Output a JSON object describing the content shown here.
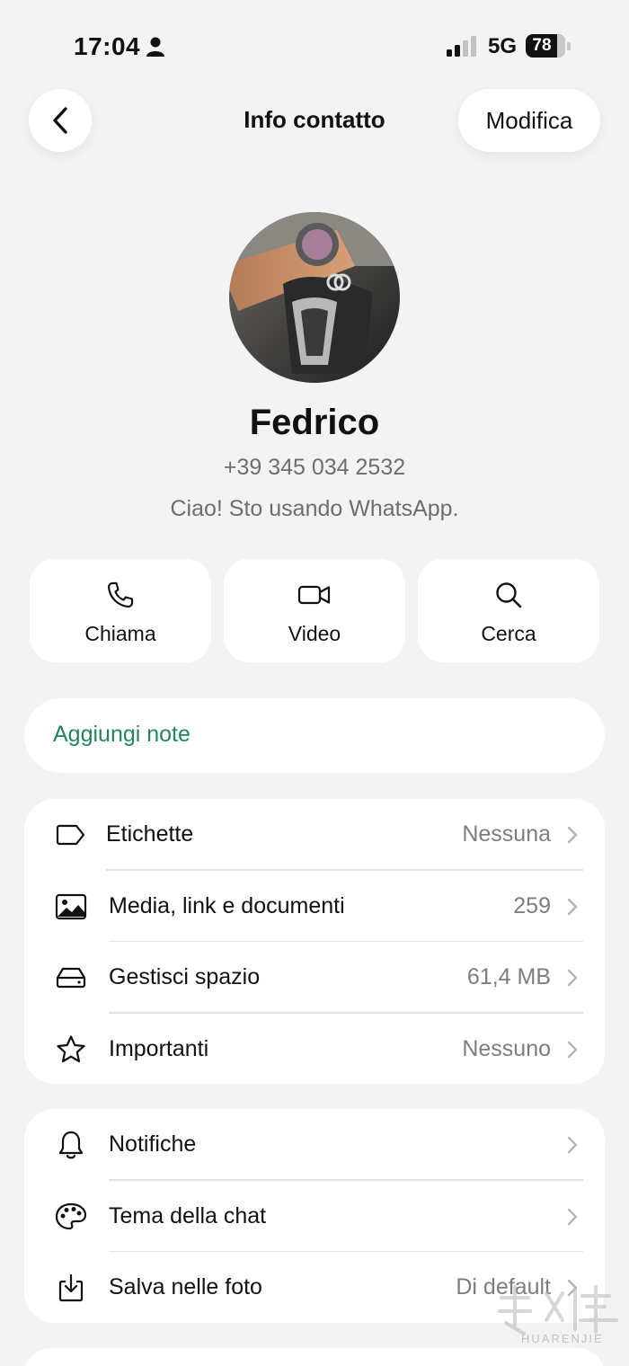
{
  "status_bar": {
    "time": "17:04",
    "network": "5G",
    "battery": "78"
  },
  "nav": {
    "title": "Info contatto",
    "edit_label": "Modifica"
  },
  "contact": {
    "name": "Fedrico",
    "phone": "+39 345 034 2532",
    "about": "Ciao! Sto usando WhatsApp."
  },
  "actions": [
    {
      "label": "Chiama",
      "icon": "phone-icon"
    },
    {
      "label": "Video",
      "icon": "video-camera-icon"
    },
    {
      "label": "Cerca",
      "icon": "search-icon"
    }
  ],
  "notes": {
    "label": "Aggiungi note",
    "color": "#21875a"
  },
  "card1": [
    {
      "label": "Etichette",
      "value": "Nessuna",
      "icon": "label-tag-icon"
    },
    {
      "label": "Media, link e documenti",
      "value": "259",
      "icon": "image-gallery-icon"
    },
    {
      "label": "Gestisci spazio",
      "value": "61,4 MB",
      "icon": "storage-drive-icon"
    },
    {
      "label": "Importanti",
      "value": "Nessuno",
      "icon": "star-icon"
    }
  ],
  "card2": [
    {
      "label": "Notifiche",
      "value": "",
      "icon": "bell-icon"
    },
    {
      "label": "Tema della chat",
      "value": "",
      "icon": "palette-icon"
    },
    {
      "label": "Salva nelle foto",
      "value": "Di default",
      "icon": "save-download-icon"
    }
  ],
  "watermark": {
    "text": "HUARENJIE"
  },
  "colors": {
    "accent_green": "#21875a",
    "background": "#f3f3f3",
    "card": "#ffffff",
    "secondary_text": "#7d7d7d"
  }
}
